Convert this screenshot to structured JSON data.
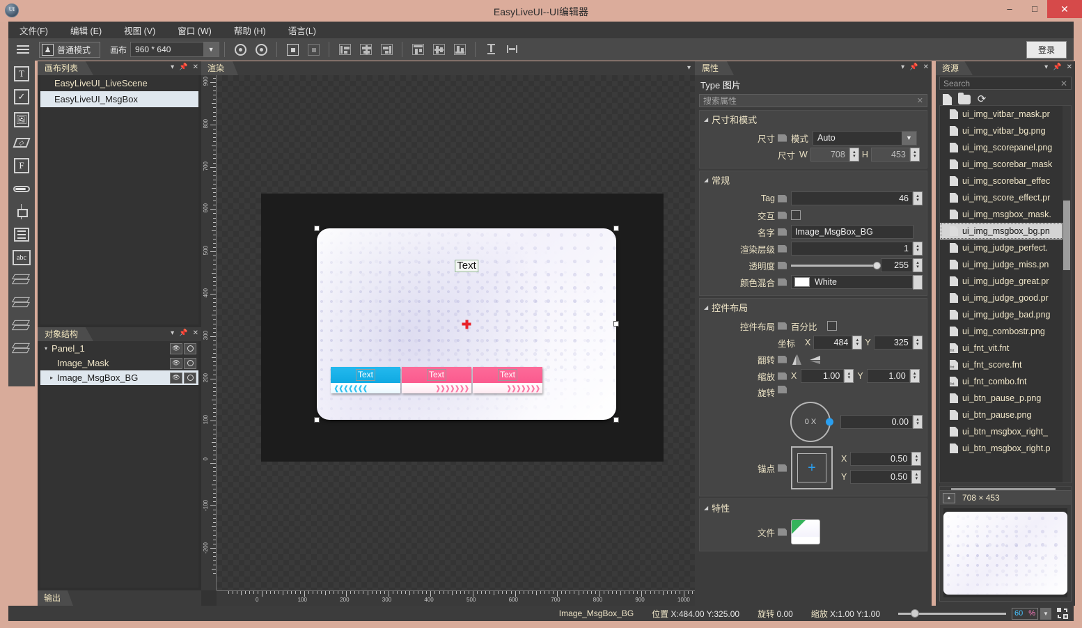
{
  "window": {
    "title": "EasyLiveUI--UI编辑器",
    "minimize": "–",
    "maximize": "□",
    "close": "✕"
  },
  "menu": [
    {
      "label": "文件(F)"
    },
    {
      "label": "编辑 (E)"
    },
    {
      "label": "视图 (V)"
    },
    {
      "label": "窗口 (W)"
    },
    {
      "label": "帮助 (H)"
    },
    {
      "label": "语言(L)"
    }
  ],
  "toolbar": {
    "mode_label": "普通模式",
    "canvas_label": "画布",
    "canvas_size": "960 * 640",
    "login_label": "登录"
  },
  "canvas_list": {
    "tab": "画布列表",
    "items": [
      {
        "label": "EasyLiveUI_LiveScene",
        "selected": false
      },
      {
        "label": "EasyLiveUI_MsgBox",
        "selected": true
      }
    ]
  },
  "object_structure": {
    "tab": "对象结构",
    "rows": [
      {
        "label": "Panel_1",
        "indent": 0,
        "tri": "▾",
        "selected": false
      },
      {
        "label": "Image_Mask",
        "indent": 1,
        "tri": "",
        "selected": false
      },
      {
        "label": "Image_MsgBox_BG",
        "indent": 1,
        "tri": "▸",
        "selected": true
      }
    ]
  },
  "output": {
    "tab": "输出"
  },
  "render": {
    "tab": "渲染",
    "hruler_ticks": [
      "0",
      "100",
      "200",
      "300",
      "400",
      "500",
      "600",
      "700",
      "800",
      "900",
      "1000"
    ],
    "vruler_ticks": [
      "900",
      "800",
      "700",
      "600",
      "500",
      "400",
      "300",
      "200",
      "100",
      "0",
      "-100",
      "-200"
    ],
    "msgbox": {
      "title_text": "Text",
      "buttons": [
        {
          "label": "Text",
          "color": "blue"
        },
        {
          "label": "Text",
          "color": "pink"
        },
        {
          "label": "Text",
          "color": "pink"
        }
      ]
    }
  },
  "properties": {
    "tab": "属性",
    "type_label": "Type",
    "type_value": "图片",
    "search_placeholder": "搜索属性",
    "groups": [
      {
        "title": "尺寸和模式",
        "rows": [
          {
            "label": "尺寸",
            "kind": "combo",
            "sub_label": "模式",
            "value": "Auto"
          },
          {
            "label": "",
            "kind": "wh",
            "sub_label": "尺寸",
            "w_label": "W",
            "w": "708",
            "h_label": "H",
            "h": "453"
          }
        ]
      },
      {
        "title": "常规",
        "rows": [
          {
            "label": "Tag",
            "kind": "spin",
            "value": "46"
          },
          {
            "label": "交互",
            "kind": "check",
            "value": ""
          },
          {
            "label": "名字",
            "kind": "text",
            "value": "Image_MsgBox_BG"
          },
          {
            "label": "渲染层级",
            "kind": "spin",
            "value": "1"
          },
          {
            "label": "透明度",
            "kind": "slider",
            "value": "255"
          },
          {
            "label": "颜色混合",
            "kind": "color",
            "value": "White",
            "hex": "#ffffff"
          }
        ]
      },
      {
        "title": "控件布局",
        "rows": [
          {
            "label": "控件布局",
            "kind": "percent",
            "sub_label": "百分比"
          },
          {
            "label": "",
            "kind": "xy",
            "sub_label": "坐标",
            "x_label": "X",
            "x": "484",
            "y_label": "Y",
            "y": "325"
          },
          {
            "label": "翻转",
            "kind": "flip"
          },
          {
            "label": "缩放",
            "kind": "xy2",
            "x_label": "X",
            "x": "1.00",
            "y_label": "Y",
            "y": "1.00"
          },
          {
            "label": "旋转",
            "kind": "dial",
            "dial_text": "0 X",
            "value": "0.00"
          },
          {
            "label": "锚点",
            "kind": "anchor",
            "x_label": "X",
            "x": "0.50",
            "y_label": "Y",
            "y": "0.50"
          }
        ]
      },
      {
        "title": "特性",
        "rows": [
          {
            "label": "文件",
            "kind": "file"
          }
        ]
      }
    ]
  },
  "resources": {
    "tab": "资源",
    "search_placeholder": "Search",
    "files": [
      {
        "name": "ui_btn_msgbox_right.p",
        "type": "png",
        "selected": false
      },
      {
        "name": "ui_btn_msgbox_right_",
        "type": "png",
        "selected": false
      },
      {
        "name": "ui_btn_pause.png",
        "type": "png",
        "selected": false
      },
      {
        "name": "ui_btn_pause_p.png",
        "type": "png",
        "selected": false
      },
      {
        "name": "ui_fnt_combo.fnt",
        "type": "fnt",
        "selected": false
      },
      {
        "name": "ui_fnt_score.fnt",
        "type": "fnt",
        "selected": false
      },
      {
        "name": "ui_fnt_vit.fnt",
        "type": "fnt",
        "selected": false
      },
      {
        "name": "ui_img_combostr.png",
        "type": "png",
        "selected": false
      },
      {
        "name": "ui_img_judge_bad.png",
        "type": "png",
        "selected": false
      },
      {
        "name": "ui_img_judge_good.pr",
        "type": "png",
        "selected": false
      },
      {
        "name": "ui_img_judge_great.pr",
        "type": "png",
        "selected": false
      },
      {
        "name": "ui_img_judge_miss.pn",
        "type": "png",
        "selected": false
      },
      {
        "name": "ui_img_judge_perfect.",
        "type": "png",
        "selected": false
      },
      {
        "name": "ui_img_msgbox_bg.pn",
        "type": "png",
        "selected": true
      },
      {
        "name": "ui_img_msgbox_mask.",
        "type": "png",
        "selected": false
      },
      {
        "name": "ui_img_score_effect.pr",
        "type": "png",
        "selected": false
      },
      {
        "name": "ui_img_scorebar_effec",
        "type": "png",
        "selected": false
      },
      {
        "name": "ui_img_scorebar_mask",
        "type": "png",
        "selected": false
      },
      {
        "name": "ui_img_scorepanel.png",
        "type": "png",
        "selected": false
      },
      {
        "name": "ui_img_vitbar_bg.png",
        "type": "png",
        "selected": false
      },
      {
        "name": "ui_img_vitbar_mask.pr",
        "type": "png",
        "selected": false
      }
    ],
    "preview": {
      "dimensions": "708  ×  453"
    }
  },
  "status": {
    "object_name": "Image_MsgBox_BG",
    "position_label": "位置",
    "position_value": "X:484.00   Y:325.00",
    "rotation_label": "旋转",
    "rotation_value": "0.00",
    "scale_label": "缩放",
    "scale_value": "X:1.00   Y:1.00",
    "zoom_value": "60",
    "zoom_unit": "%"
  },
  "colors": {
    "accent_blue": "#2a9ff0",
    "title_bar": "#dbac9b",
    "panel_bg": "#3c3c3c",
    "close_red": "#d64a4a"
  }
}
